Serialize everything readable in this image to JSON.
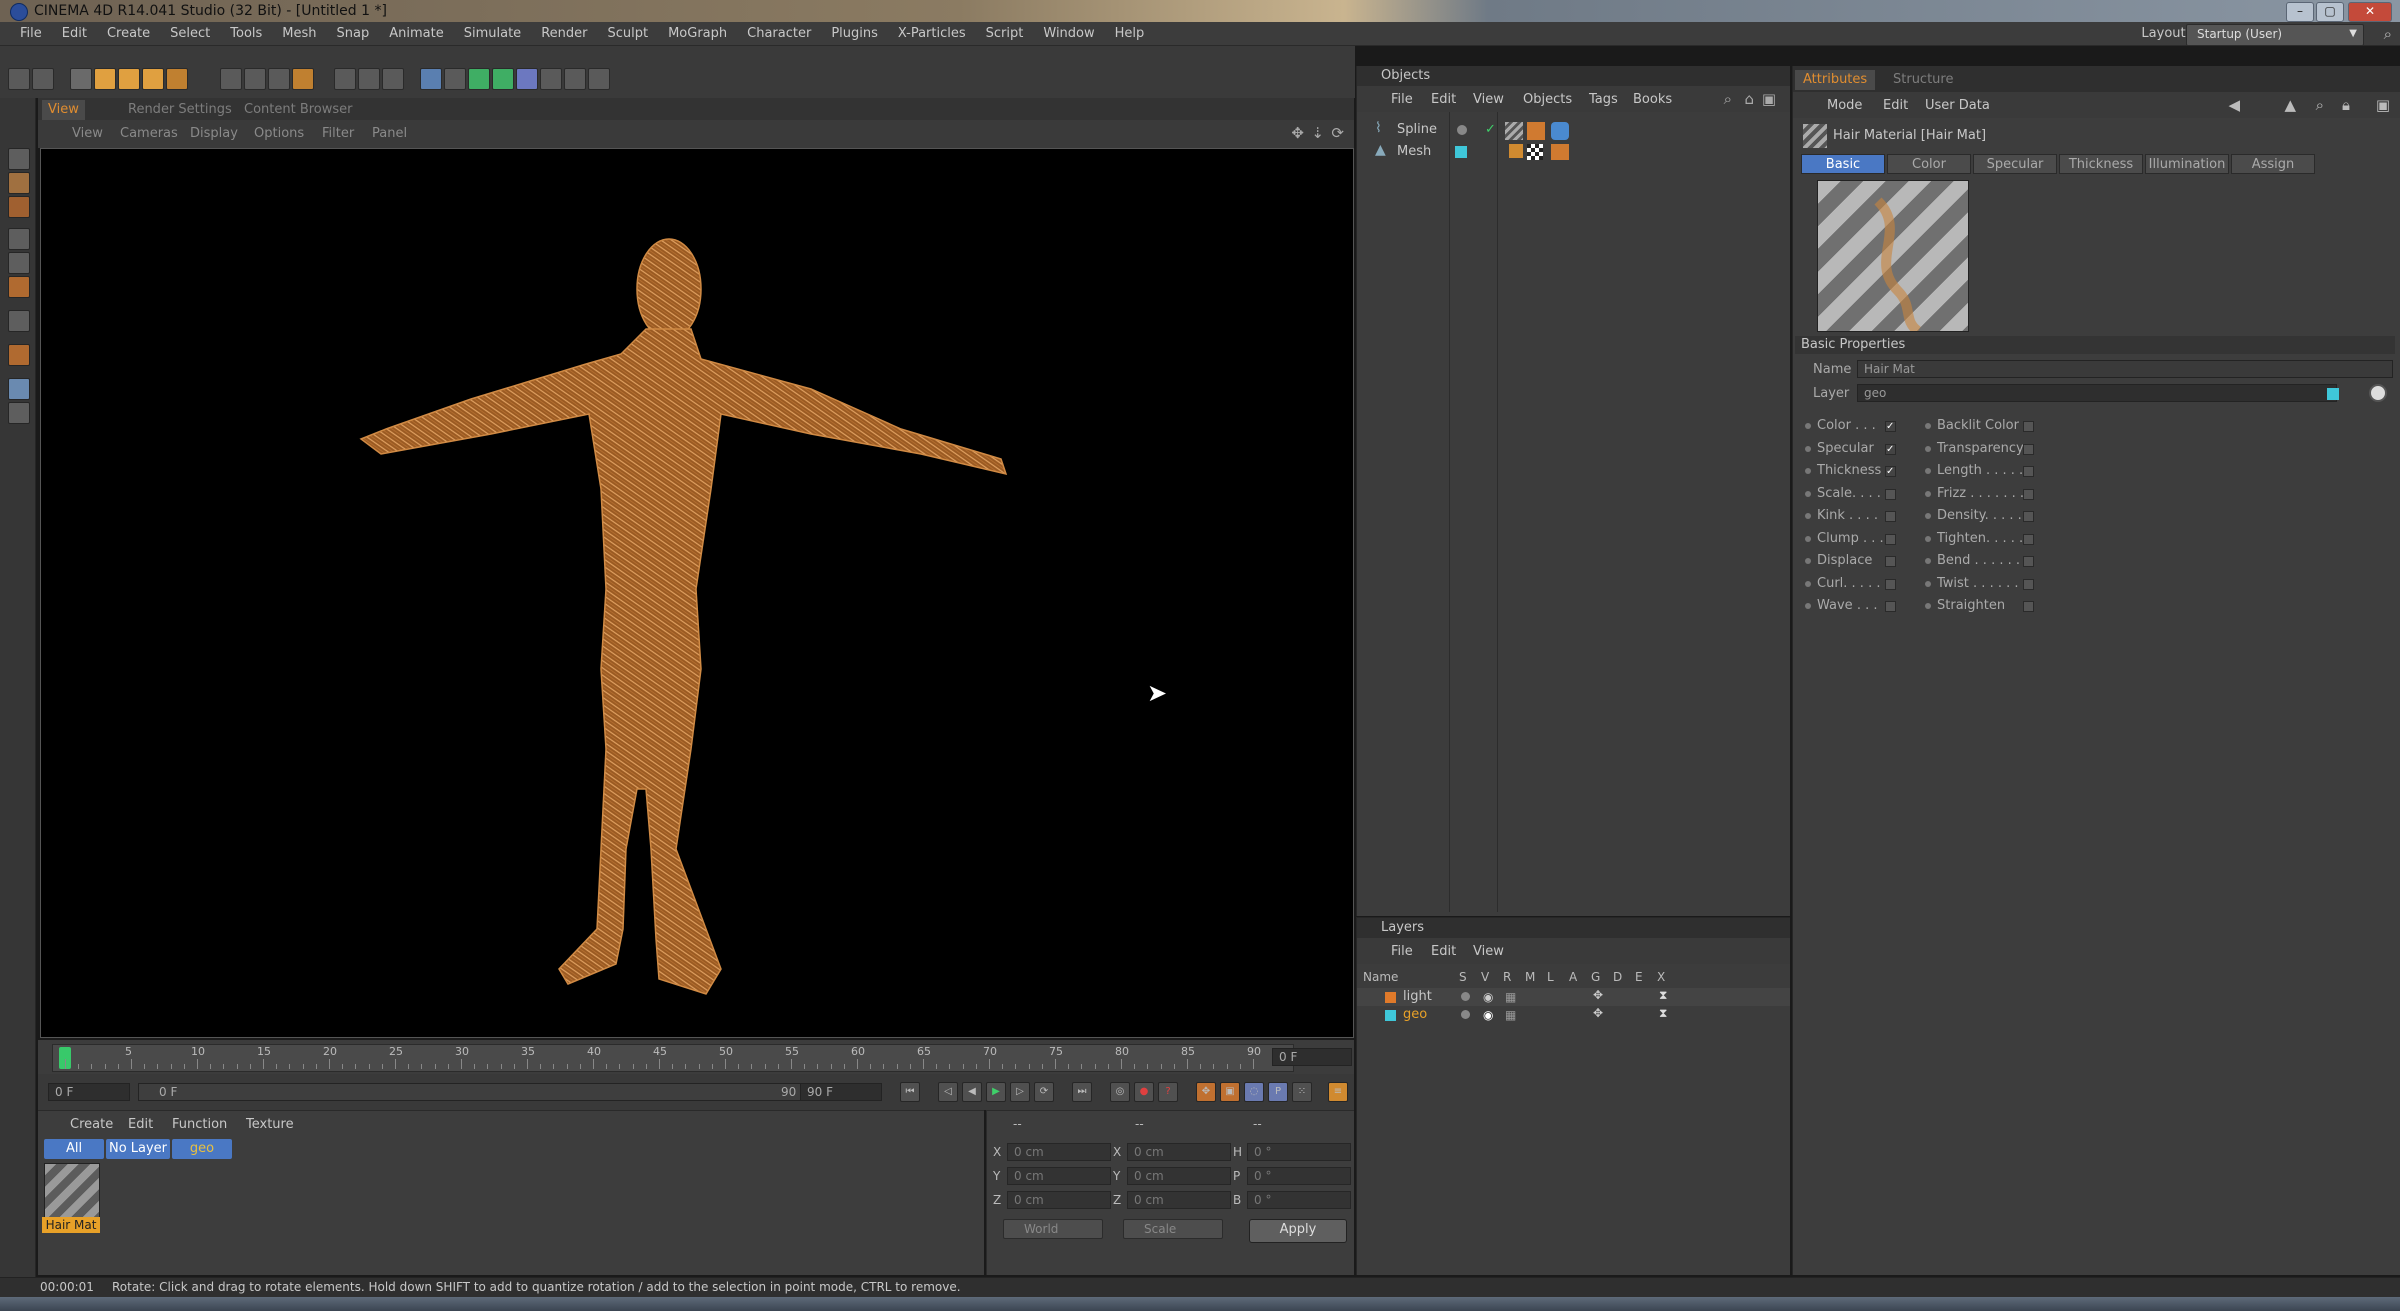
{
  "window": {
    "title": "CINEMA 4D R14.041 Studio (32 Bit) - [Untitled 1 *]",
    "controls": [
      "–",
      "▢",
      "✕"
    ]
  },
  "menubar": {
    "items": [
      "File",
      "Edit",
      "Create",
      "Select",
      "Tools",
      "Mesh",
      "Snap",
      "Animate",
      "Simulate",
      "Render",
      "Sculpt",
      "MoGraph",
      "Character",
      "Plugins",
      "X-Particles",
      "Script",
      "Window",
      "Help"
    ],
    "layout_label": "Layout:",
    "layout_value": "Startup (User)"
  },
  "viewport": {
    "tabs": [
      "View",
      "Render Settings",
      "Content Browser"
    ],
    "menu": [
      "View",
      "Cameras",
      "Display",
      "Options",
      "Filter",
      "Panel"
    ]
  },
  "timeline": {
    "ticks": [
      "0",
      "5",
      "10",
      "15",
      "20",
      "25",
      "30",
      "35",
      "40",
      "45",
      "50",
      "55",
      "60",
      "65",
      "70",
      "75",
      "80",
      "85",
      "90"
    ],
    "current_frame_field": "0 F",
    "start_field": "0 F",
    "range_start": "0 F",
    "range_end": "90 F",
    "end_field": "90 F"
  },
  "material_manager": {
    "menu": [
      "Create",
      "Edit",
      "Function",
      "Texture"
    ],
    "filters": [
      "All",
      "No Layer",
      "geo"
    ],
    "materials": [
      {
        "name": "Hair Mat"
      }
    ]
  },
  "coordinates": {
    "header_left": "--",
    "header_mid": "--",
    "header_right": "--",
    "rows": [
      {
        "a": "X",
        "av": "0 cm",
        "b": "X",
        "bv": "0 cm",
        "c": "H",
        "cv": "0 °"
      },
      {
        "a": "Y",
        "av": "0 cm",
        "b": "Y",
        "bv": "0 cm",
        "c": "P",
        "cv": "0 °"
      },
      {
        "a": "Z",
        "av": "0 cm",
        "b": "Z",
        "bv": "0 cm",
        "c": "B",
        "cv": "0 °"
      }
    ],
    "dropdown_space": "World",
    "dropdown_mode": "Scale",
    "apply_label": "Apply"
  },
  "status": {
    "time": "00:00:01",
    "message": "Rotate: Click and drag to rotate elements. Hold down SHIFT to add to quantize rotation / add to the selection in point mode, CTRL to remove."
  },
  "objects_panel": {
    "title": "Objects",
    "menu": [
      "File",
      "Edit",
      "View",
      "Objects",
      "Tags",
      "Books"
    ],
    "items": [
      {
        "name": "Spline",
        "color": "#8a8a8a"
      },
      {
        "name": "Mesh",
        "color": "#3fc7d9"
      }
    ]
  },
  "layers_panel": {
    "title": "Layers",
    "menu": [
      "File",
      "Edit",
      "View"
    ],
    "columns": [
      "Name",
      "S",
      "V",
      "R",
      "M",
      "L",
      "A",
      "G",
      "D",
      "E",
      "X"
    ],
    "layers": [
      {
        "name": "light",
        "color": "#e07a2a"
      },
      {
        "name": "geo",
        "color": "#3fc7d9"
      }
    ]
  },
  "attributes_panel": {
    "tabs": [
      "Attributes",
      "Structure"
    ],
    "menu": [
      "Mode",
      "Edit",
      "User Data"
    ],
    "object_title": "Hair Material [Hair Mat]",
    "sub_tabs": [
      "Basic",
      "Color",
      "Specular",
      "Thickness",
      "Illumination",
      "Assign"
    ],
    "section": "Basic Properties",
    "name_label": "Name",
    "name_value": "Hair Mat",
    "layer_label": "Layer",
    "layer_value": "geo",
    "left_props": [
      {
        "label": "Color . . .",
        "checked": true
      },
      {
        "label": "Specular",
        "checked": true
      },
      {
        "label": "Thickness",
        "checked": true
      },
      {
        "label": "Scale. . . .",
        "checked": false
      },
      {
        "label": "Kink . . . .",
        "checked": false
      },
      {
        "label": "Clump . . .",
        "checked": false
      },
      {
        "label": "Displace",
        "checked": false
      },
      {
        "label": "Curl. . . . .",
        "checked": false
      },
      {
        "label": "Wave . . .",
        "checked": false
      }
    ],
    "right_props": [
      {
        "label": "Backlit Color",
        "checked": false
      },
      {
        "label": "Transparency",
        "checked": false
      },
      {
        "label": "Length . . . . .",
        "checked": false
      },
      {
        "label": "Frizz . . . . . . .",
        "checked": false
      },
      {
        "label": "Density. . . . .",
        "checked": false
      },
      {
        "label": "Tighten. . . . .",
        "checked": false
      },
      {
        "label": "Bend . . . . . .",
        "checked": false
      },
      {
        "label": "Twist . . . . . .",
        "checked": false
      },
      {
        "label": "Straighten",
        "checked": false
      }
    ]
  },
  "colors": {
    "accent": "#e08d30",
    "selection": "#4a78c4",
    "hair": "#c8843c"
  }
}
